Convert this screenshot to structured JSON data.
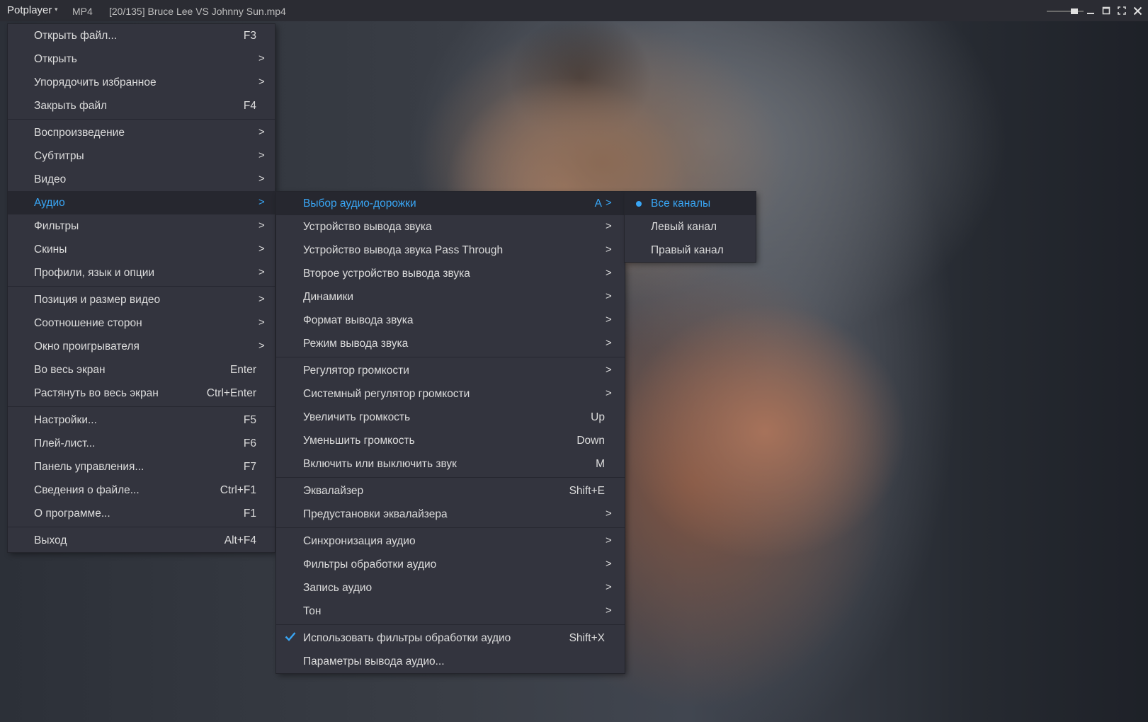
{
  "titlebar": {
    "app_name": "Potplayer",
    "format": "MP4",
    "title": "[20/135] Bruce Lee VS Johnny Sun.mp4"
  },
  "accent_color": "#39a6f5",
  "main_menu": {
    "items": [
      {
        "label": "Открыть файл...",
        "shortcut": "F3"
      },
      {
        "label": "Открыть",
        "arrow": ">"
      },
      {
        "label": "Упорядочить избранное",
        "arrow": ">"
      },
      {
        "label": "Закрыть файл",
        "shortcut": "F4"
      },
      {
        "label": "Воспроизведение",
        "arrow": ">"
      },
      {
        "label": "Субтитры",
        "arrow": ">"
      },
      {
        "label": "Видео",
        "arrow": ">"
      },
      {
        "label": "Аудио",
        "arrow": ">"
      },
      {
        "label": "Фильтры",
        "arrow": ">"
      },
      {
        "label": "Скины",
        "arrow": ">"
      },
      {
        "label": "Профили, язык и опции",
        "arrow": ">"
      },
      {
        "label": "Позиция и размер видео",
        "arrow": ">"
      },
      {
        "label": "Соотношение сторон",
        "arrow": ">"
      },
      {
        "label": "Окно проигрывателя",
        "arrow": ">"
      },
      {
        "label": "Во весь экран",
        "shortcut": "Enter"
      },
      {
        "label": "Растянуть во весь экран",
        "shortcut": "Ctrl+Enter"
      },
      {
        "label": "Настройки...",
        "shortcut": "F5"
      },
      {
        "label": "Плей-лист...",
        "shortcut": "F6"
      },
      {
        "label": "Панель управления...",
        "shortcut": "F7"
      },
      {
        "label": "Сведения о файле...",
        "shortcut": "Ctrl+F1"
      },
      {
        "label": "О программе...",
        "shortcut": "F1"
      },
      {
        "label": "Выход",
        "shortcut": "Alt+F4"
      }
    ]
  },
  "audio_menu": {
    "items": [
      {
        "label": "Выбор аудио-дорожки",
        "shortcut": "A",
        "arrow": ">"
      },
      {
        "label": "Устройство вывода звука",
        "arrow": ">"
      },
      {
        "label": "Устройство вывода звука Pass Through",
        "arrow": ">"
      },
      {
        "label": "Второе устройство вывода звука",
        "arrow": ">"
      },
      {
        "label": "Динамики",
        "arrow": ">"
      },
      {
        "label": "Формат вывода звука",
        "arrow": ">"
      },
      {
        "label": "Режим вывода звука",
        "arrow": ">"
      },
      {
        "label": "Регулятор громкости",
        "arrow": ">"
      },
      {
        "label": "Системный регулятор громкости",
        "arrow": ">"
      },
      {
        "label": "Увеличить громкость",
        "shortcut": "Up"
      },
      {
        "label": "Уменьшить громкость",
        "shortcut": "Down"
      },
      {
        "label": "Включить или выключить звук",
        "shortcut": "M"
      },
      {
        "label": "Эквалайзер",
        "shortcut": "Shift+E"
      },
      {
        "label": "Предустановки эквалайзера",
        "arrow": ">"
      },
      {
        "label": "Синхронизация аудио",
        "arrow": ">"
      },
      {
        "label": "Фильтры обработки аудио",
        "arrow": ">"
      },
      {
        "label": "Запись аудио",
        "arrow": ">"
      },
      {
        "label": "Тон",
        "arrow": ">"
      },
      {
        "label": "Использовать фильтры обработки аудио",
        "shortcut": "Shift+X"
      },
      {
        "label": "Параметры вывода аудио..."
      }
    ]
  },
  "channel_menu": {
    "items": [
      {
        "label": "Все каналы"
      },
      {
        "label": "Левый канал"
      },
      {
        "label": "Правый канал"
      }
    ]
  }
}
